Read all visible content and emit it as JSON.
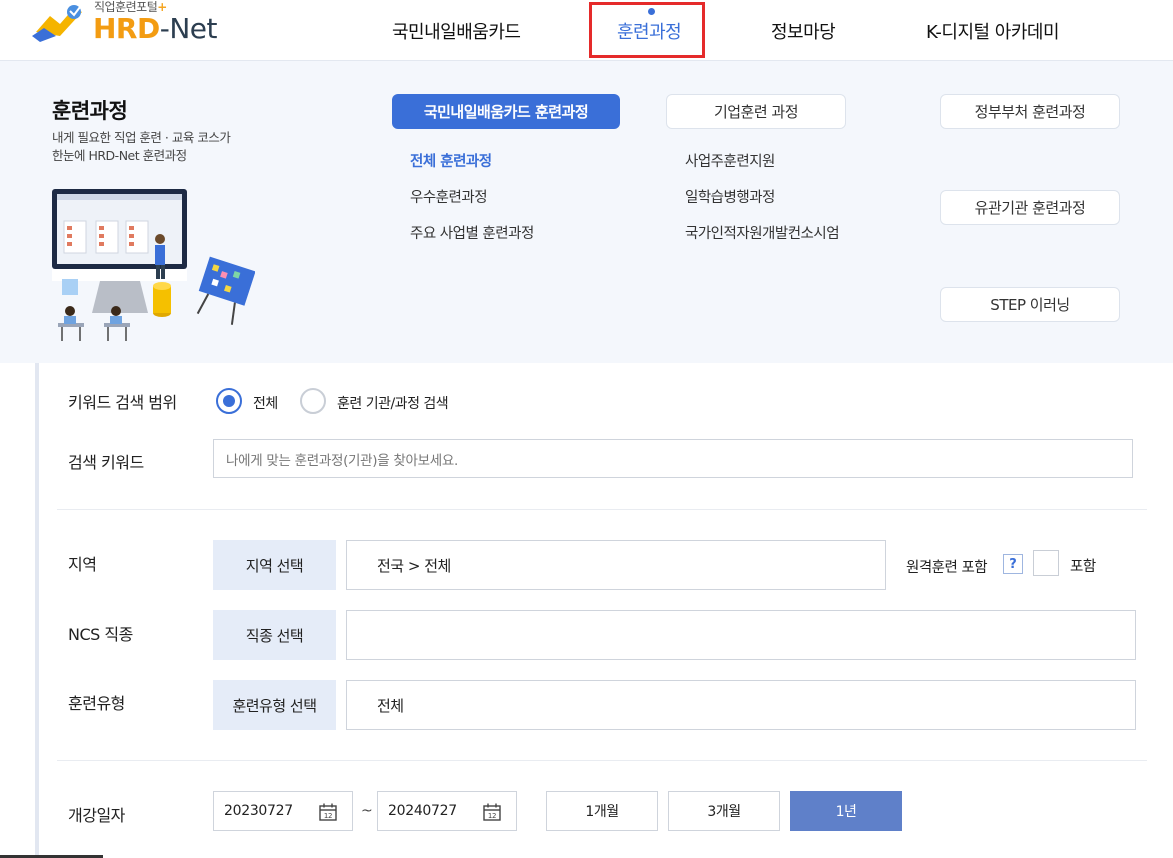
{
  "header": {
    "logo_sub": "직업훈련포털",
    "logo_plus": "+",
    "logo_hrd": "HRD",
    "logo_net": "-Net",
    "nav": [
      {
        "label": "국민내일배움카드"
      },
      {
        "label": "훈련과정"
      },
      {
        "label": "정보마당"
      },
      {
        "label": "K-디지털 아카데미"
      }
    ]
  },
  "mega": {
    "title": "훈련과정",
    "desc_line1": "내게 필요한 직업 훈련 · 교육 코스가",
    "desc_line2": "한눈에 HRD-Net 훈련과정",
    "col1": {
      "button": "국민내일배움카드 훈련과정",
      "links": [
        "전체 훈련과정",
        "우수훈련과정",
        "주요 사업별 훈련과정"
      ]
    },
    "col2": {
      "button": "기업훈련 과정",
      "links": [
        "사업주훈련지원",
        "일학습병행과정",
        "국가인적자원개발컨소시엄"
      ]
    },
    "col3": {
      "buttons": [
        "정부부처 훈련과정",
        "유관기관 훈련과정",
        "STEP 이러닝"
      ]
    }
  },
  "form": {
    "keyword_scope_label": "키워드 검색 범위",
    "scope_options": [
      "전체",
      "훈련 기관/과정 검색"
    ],
    "scope_selected": "전체",
    "keyword_label": "검색 키워드",
    "keyword_placeholder": "나에게 맞는 훈련과정(기관)을 찾아보세요.",
    "region_label": "지역",
    "region_button": "지역 선택",
    "region_value": "전국 > 전체",
    "remote_label": "원격훈련 포함",
    "remote_help": "?",
    "remote_checkbox_label": "포함",
    "ncs_label": "NCS 직종",
    "ncs_button": "직종 선택",
    "ncs_value": "",
    "type_label": "훈련유형",
    "type_button": "훈련유형 선택",
    "type_value": "전체",
    "date_label": "개강일자",
    "date_start": "20230727",
    "date_end": "20240727",
    "date_sep": "~",
    "periods": [
      "1개월",
      "3개월",
      "1년"
    ],
    "period_selected": "1년"
  },
  "colors": {
    "accent": "#3a6fd8",
    "highlight_box": "#e52a2a",
    "panel_bg": "#f4f7fc",
    "select_bg": "#e5ecf8"
  }
}
